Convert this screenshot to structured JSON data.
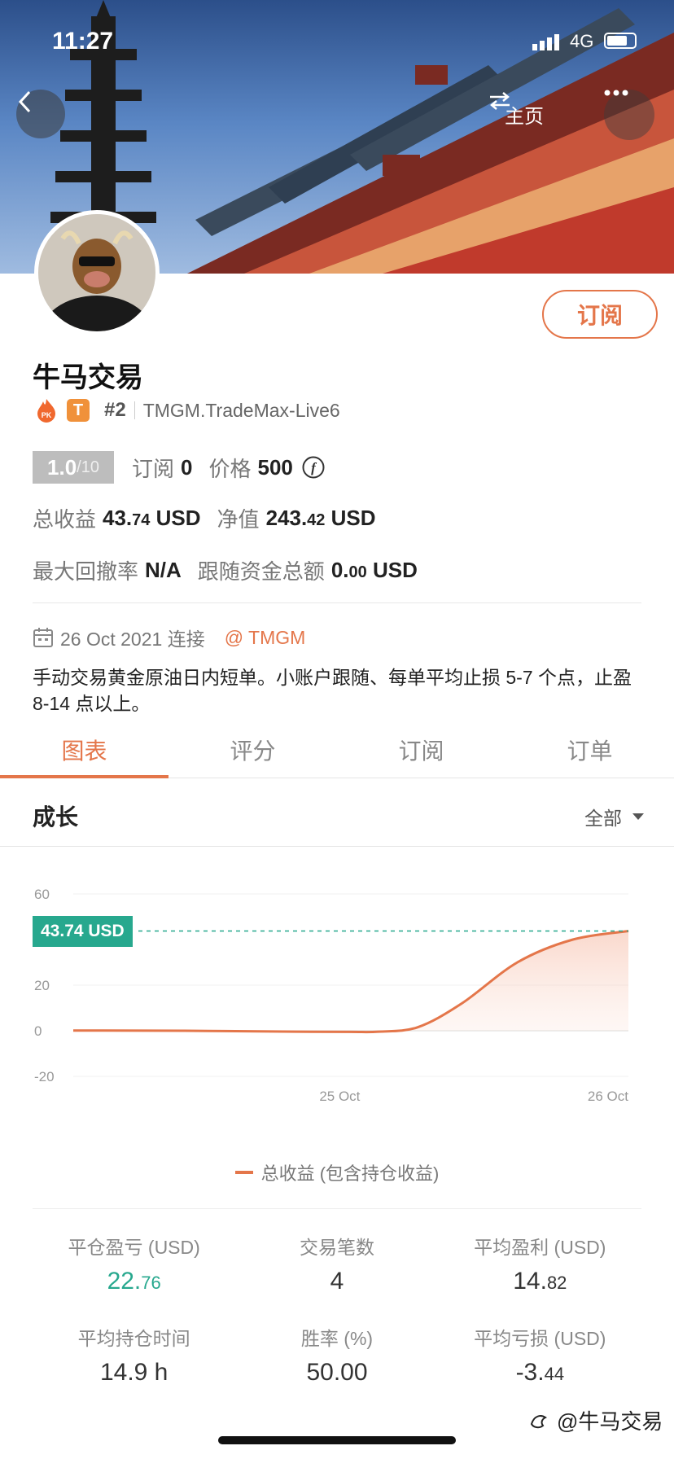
{
  "status_bar": {
    "time": "11:27",
    "network": "4G"
  },
  "header": {
    "home_label": "主页"
  },
  "profile": {
    "name": "牛马交易",
    "subscribe_label": "订阅",
    "tier_badge": "T",
    "rank": "#2",
    "account": "TMGM.TradeMax-Live6",
    "score": "1.0",
    "score_max": "/10",
    "subscribe_count_label": "订阅",
    "subscribe_count": "0",
    "price_label": "价格",
    "price": "500",
    "total_profit_label": "总收益",
    "total_profit_int": "43.",
    "total_profit_dec": "74",
    "total_profit_unit": " USD",
    "equity_label": "净值",
    "equity_int": "243.",
    "equity_dec": "42",
    "equity_unit": " USD",
    "drawdown_label": "最大回撤率",
    "drawdown": "N/A",
    "follow_label": "跟随资金总额",
    "follow_int": "0.",
    "follow_dec": "00",
    "follow_unit": " USD",
    "connected": "26 Oct 2021 连接",
    "broker": "@ TMGM",
    "description": "手动交易黄金原油日内短单。小账户跟随、每单平均止损 5-7 个点，止盈 8-14 点以上。"
  },
  "tabs": [
    "图表",
    "评分",
    "订阅",
    "订单"
  ],
  "section": {
    "title": "成长",
    "filter": "全部"
  },
  "chart_data": {
    "type": "area",
    "ylim": [
      -20,
      60
    ],
    "yticks": [
      "60",
      "20",
      "0",
      "-20"
    ],
    "xticks": [
      "25 Oct",
      "26 Oct"
    ],
    "tooltip": "43.74 USD",
    "series": [
      {
        "name": "总收益 (包含持仓收益)",
        "color": "#e4764a",
        "x": [
          0,
          0.2,
          0.4,
          0.5,
          0.55,
          0.62,
          0.7,
          0.8,
          0.9,
          1.0
        ],
        "values": [
          0.1,
          0.0,
          -0.4,
          -0.5,
          -0.4,
          1.5,
          12,
          30,
          40,
          43.74
        ]
      }
    ],
    "legend": "总收益 (包含持仓收益)"
  },
  "stats": [
    {
      "label": "平仓盈亏 (USD)",
      "int": "22.",
      "dec": "76",
      "highlight": true
    },
    {
      "label": "交易笔数",
      "int": "4",
      "dec": "",
      "highlight": false
    },
    {
      "label": "平均盈利 (USD)",
      "int": "14.",
      "dec": "82",
      "highlight": false
    },
    {
      "label": "平均持仓时间",
      "int": "14.9 h",
      "dec": "",
      "highlight": false
    },
    {
      "label": "胜率 (%)",
      "int": "50.00",
      "dec": "",
      "highlight": false
    },
    {
      "label": "平均亏损 (USD)",
      "int": "-3.",
      "dec": "44",
      "highlight": false
    }
  ],
  "watermark": "@牛马交易"
}
